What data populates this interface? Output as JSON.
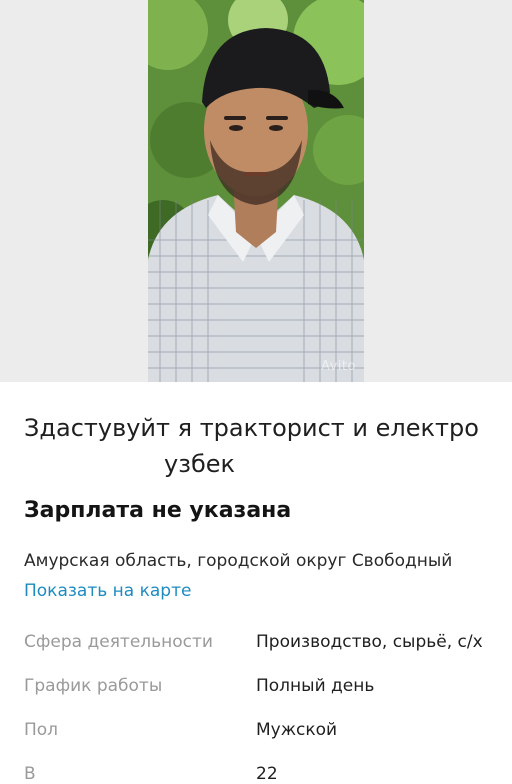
{
  "photo": {
    "watermark": "Avito"
  },
  "listing": {
    "title_line1": "Здастувуйт я тракторист и електро",
    "title_line2": "узбек",
    "salary": "Зарплата не указана",
    "address": "Амурская область, городской округ Свободный",
    "map_link": "Показать на карте"
  },
  "params": [
    {
      "label": "Сфера деятельности",
      "value": "Производство, сырьё, с/х"
    },
    {
      "label": "График работы",
      "value": "Полный день"
    },
    {
      "label": "Пол",
      "value": "Мужской"
    },
    {
      "label": "В",
      "value": "22"
    }
  ],
  "colors": {
    "link": "#1e8bbf",
    "label_gray": "#9a9a9a",
    "photo_background": "#ececec"
  }
}
